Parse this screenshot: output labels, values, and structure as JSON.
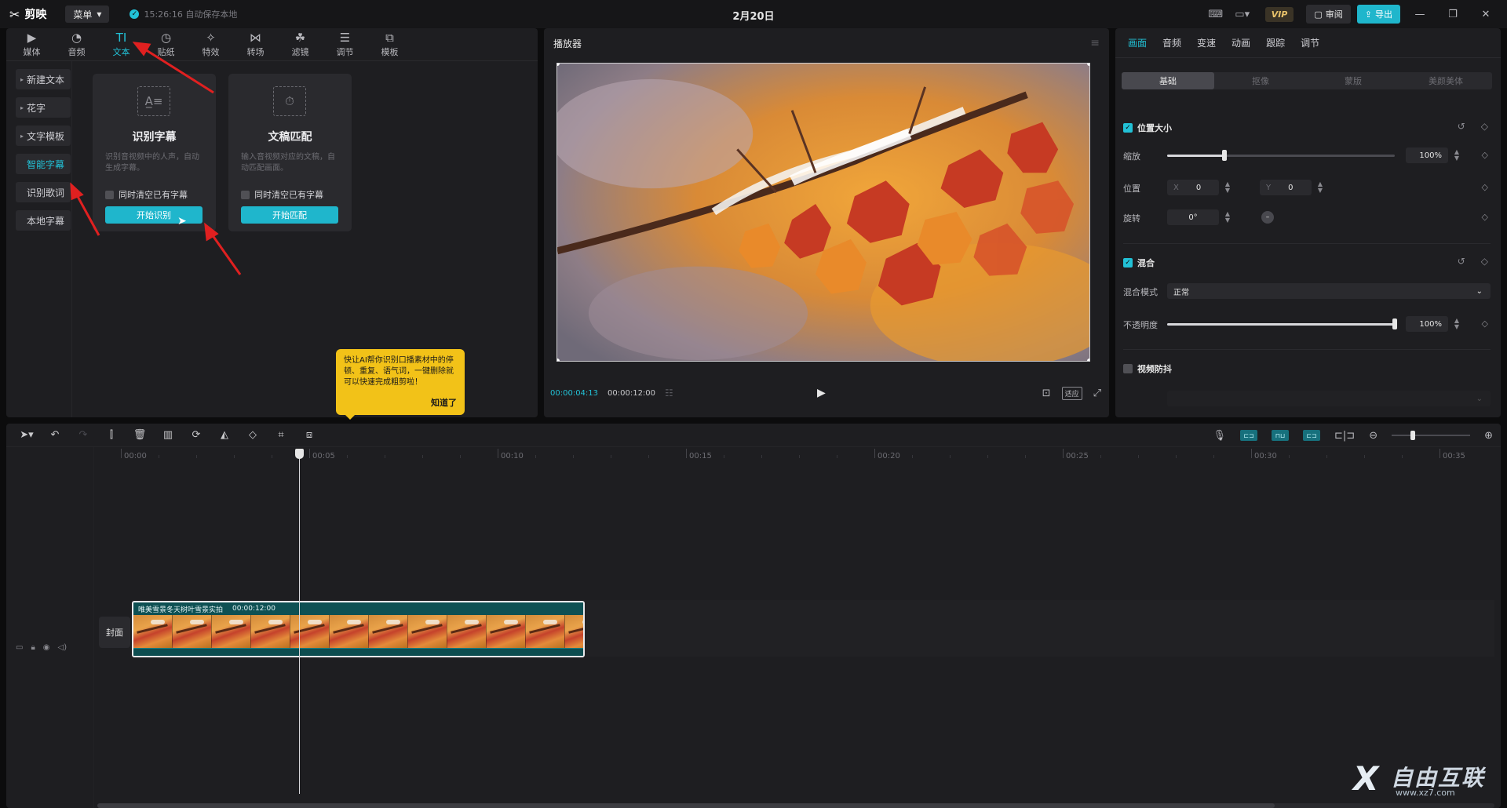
{
  "titlebar": {
    "app_name": "剪映",
    "menu_label": "菜单",
    "save_status": "15:26:16 自动保存本地",
    "document_title": "2月20日",
    "vip": "VIP",
    "review_label": "审阅",
    "export_label": "导出"
  },
  "media_tabs": [
    {
      "label": "媒体",
      "icon": "media-icon"
    },
    {
      "label": "音频",
      "icon": "audio-icon"
    },
    {
      "label": "文本",
      "icon": "text-icon",
      "active": true
    },
    {
      "label": "贴纸",
      "icon": "sticker-icon"
    },
    {
      "label": "特效",
      "icon": "effects-icon"
    },
    {
      "label": "转场",
      "icon": "transition-icon"
    },
    {
      "label": "滤镜",
      "icon": "filter-icon"
    },
    {
      "label": "调节",
      "icon": "adjust-icon"
    },
    {
      "label": "模板",
      "icon": "template-icon"
    }
  ],
  "side_nav": [
    {
      "label": "新建文本",
      "caret": true
    },
    {
      "label": "花字",
      "caret": true
    },
    {
      "label": "文字模板",
      "caret": true
    },
    {
      "label": "智能字幕",
      "active": true
    },
    {
      "label": "识别歌词"
    },
    {
      "label": "本地字幕"
    }
  ],
  "cards": [
    {
      "title": "识别字幕",
      "desc": "识别音视频中的人声，自动生成字幕。",
      "check_label": "同时清空已有字幕",
      "button": "开始识别"
    },
    {
      "title": "文稿匹配",
      "desc": "输入音视频对应的文稿，自动匹配画面。",
      "check_label": "同时清空已有字幕",
      "button": "开始匹配"
    }
  ],
  "tooltip": {
    "text": "快让AI帮你识别口播素材中的停顿、重复、语气词，一键删除就可以快速完成粗剪啦！",
    "ok": "知道了"
  },
  "player": {
    "title": "播放器",
    "current_time": "00:00:04:13",
    "total_time": "00:00:12:00",
    "ratio_label": "适应"
  },
  "props": {
    "tabs": [
      {
        "label": "画面",
        "active": true
      },
      {
        "label": "音频"
      },
      {
        "label": "变速"
      },
      {
        "label": "动画"
      },
      {
        "label": "跟踪"
      },
      {
        "label": "调节"
      }
    ],
    "segments": [
      {
        "label": "基础",
        "active": true
      },
      {
        "label": "抠像"
      },
      {
        "label": "蒙版"
      },
      {
        "label": "美颜美体"
      }
    ],
    "position_size": {
      "title": "位置大小",
      "scale_label": "缩放",
      "scale_value": "100%",
      "scale_fraction": 0.25,
      "position_label": "位置",
      "x_label": "X",
      "x_value": "0",
      "y_label": "Y",
      "y_value": "0",
      "rotate_label": "旋转",
      "rotate_value": "0°"
    },
    "blend": {
      "title": "混合",
      "mode_label": "混合模式",
      "mode_value": "正常",
      "opacity_label": "不透明度",
      "opacity_value": "100%",
      "opacity_fraction": 1.0
    },
    "stabilize": {
      "title": "视频防抖"
    }
  },
  "timeline": {
    "ticks": [
      "00:00",
      "00:05",
      "00:10",
      "00:15",
      "00:20",
      "00:25",
      "00:30",
      "00:35"
    ],
    "cover_label": "封面",
    "clip_name": "唯美雪景冬天树叶雪景实拍",
    "clip_duration": "00:00:12:00"
  },
  "watermark": {
    "brand": "自由互联",
    "url": "www.xz7.com"
  },
  "colors": {
    "accent": "#22c1d6",
    "tooltip": "#f2c218",
    "annotation_arrow": "#e02020"
  }
}
